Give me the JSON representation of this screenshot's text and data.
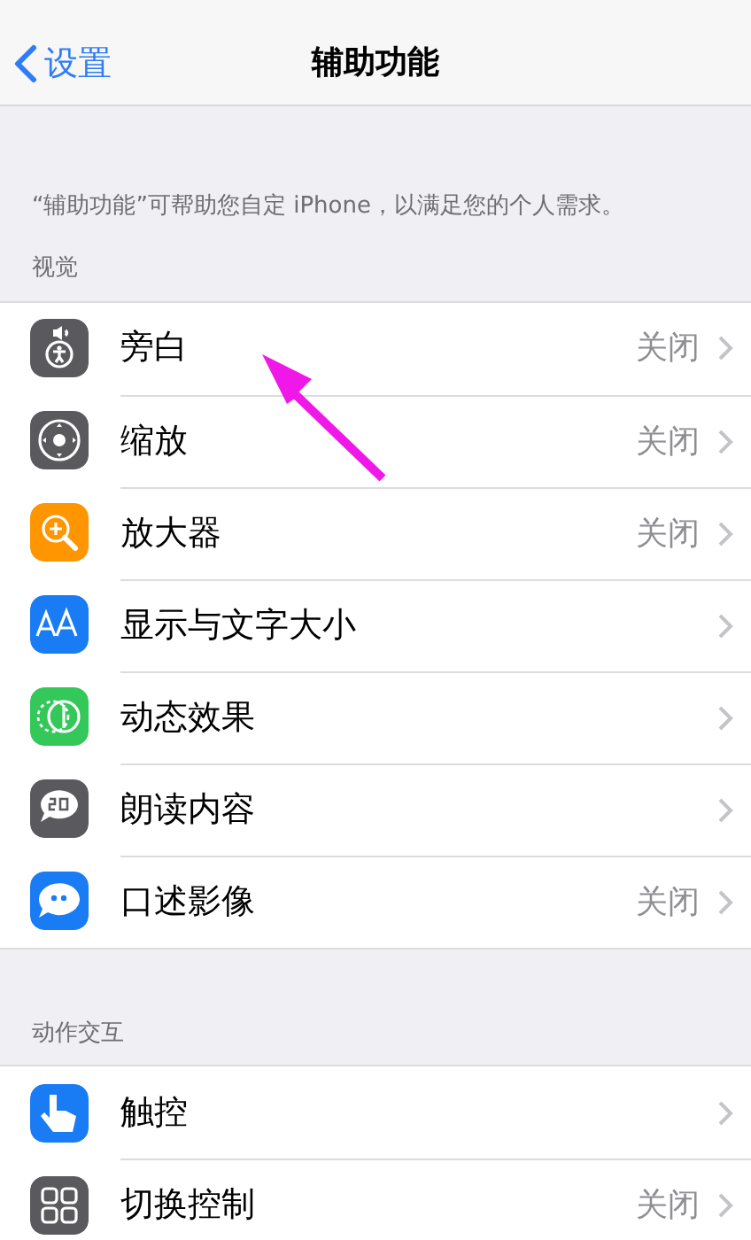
{
  "nav": {
    "back": "设置",
    "title": "辅助功能"
  },
  "description": "“辅助功能”可帮助您自定 iPhone，以满足您的个人需求。",
  "sections": [
    {
      "header": "视觉",
      "rows": [
        {
          "label": "旁白",
          "value": "关闭"
        },
        {
          "label": "缩放",
          "value": "关闭"
        },
        {
          "label": "放大器",
          "value": "关闭"
        },
        {
          "label": "显示与文字大小"
        },
        {
          "label": "动态效果"
        },
        {
          "label": "朗读内容"
        },
        {
          "label": "口述影像",
          "value": "关闭"
        }
      ]
    },
    {
      "header": "动作交互",
      "rows": [
        {
          "label": "触控"
        },
        {
          "label": "切换控制",
          "value": "关闭"
        }
      ]
    }
  ]
}
